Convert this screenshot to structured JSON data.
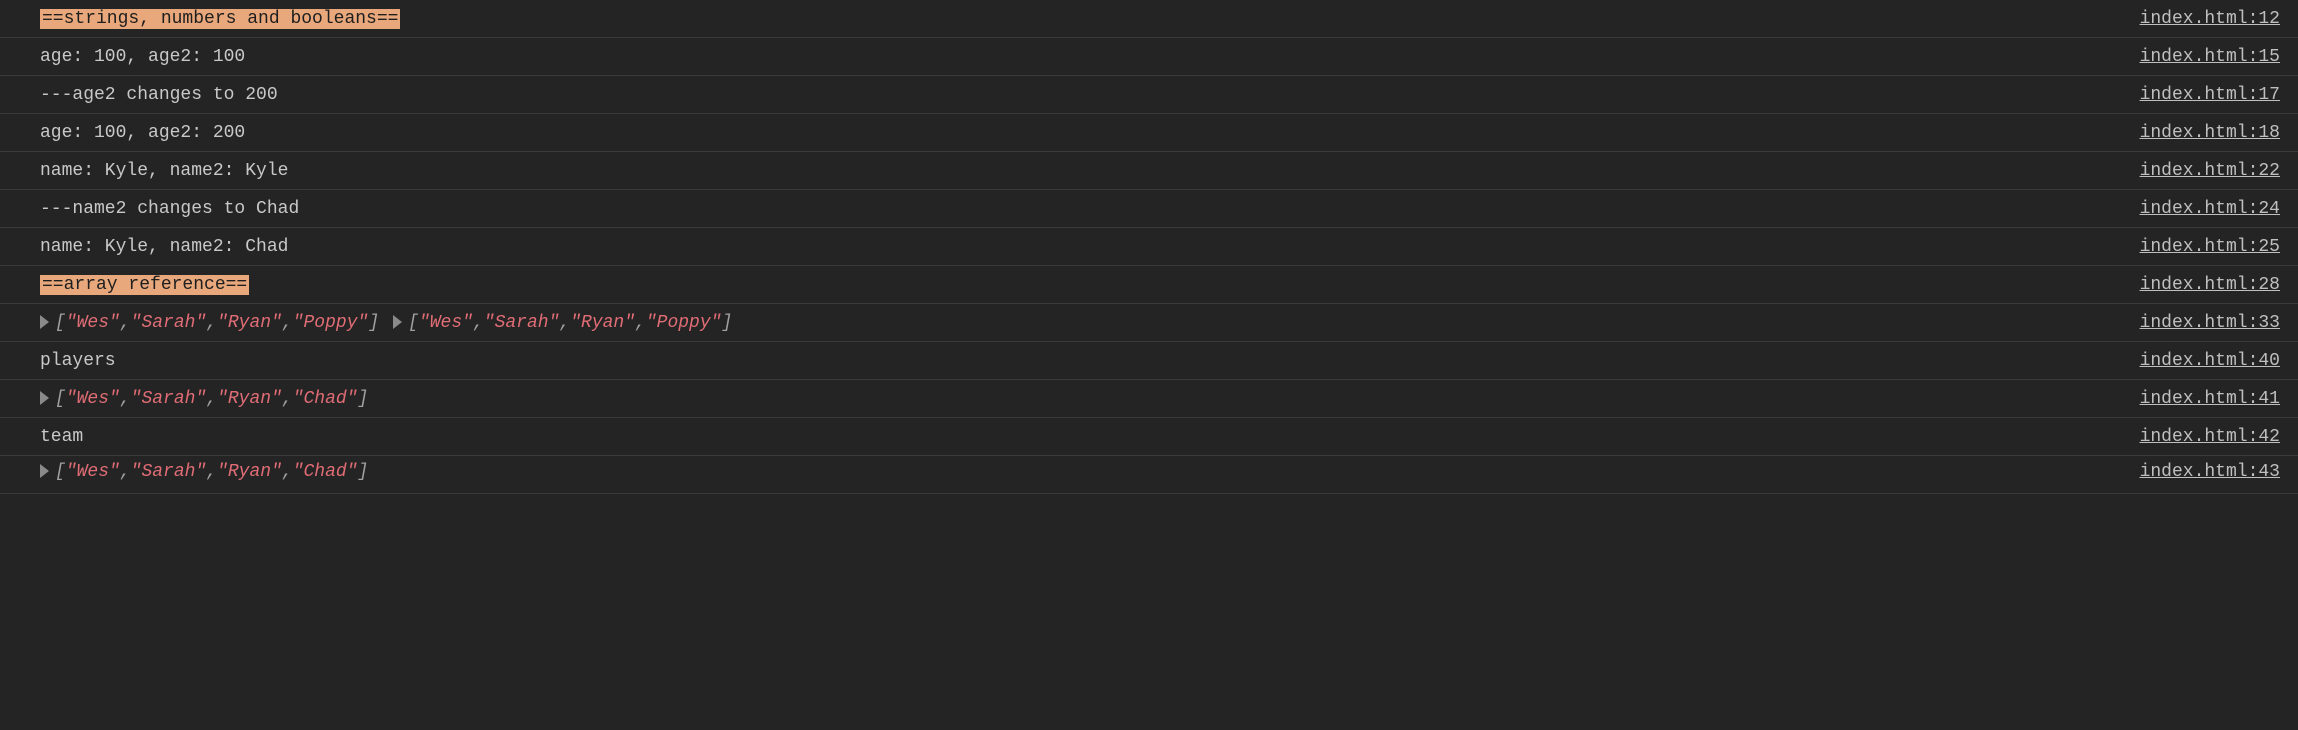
{
  "rows": [
    {
      "type": "hl",
      "text": "==strings, numbers and booleans==",
      "source": "index.html:12"
    },
    {
      "type": "plain",
      "text": "age: 100, age2: 100",
      "source": "index.html:15"
    },
    {
      "type": "plain",
      "text": "---age2 changes to 200",
      "source": "index.html:17"
    },
    {
      "type": "plain",
      "text": "age: 100, age2: 200",
      "source": "index.html:18"
    },
    {
      "type": "plain",
      "text": "name: Kyle, name2: Kyle",
      "source": "index.html:22"
    },
    {
      "type": "plain",
      "text": "---name2 changes to Chad",
      "source": "index.html:24"
    },
    {
      "type": "plain",
      "text": "name: Kyle, name2: Chad",
      "source": "index.html:25"
    },
    {
      "type": "hl",
      "text": "==array reference==",
      "source": "index.html:28"
    },
    {
      "type": "arrays",
      "arrays": [
        [
          "\"Wes\"",
          "\"Sarah\"",
          "\"Ryan\"",
          "\"Poppy\""
        ],
        [
          "\"Wes\"",
          "\"Sarah\"",
          "\"Ryan\"",
          "\"Poppy\""
        ]
      ],
      "source": "index.html:33"
    },
    {
      "type": "plain",
      "text": "players",
      "source": "index.html:40"
    },
    {
      "type": "arrays",
      "arrays": [
        [
          "\"Wes\"",
          "\"Sarah\"",
          "\"Ryan\"",
          "\"Chad\""
        ]
      ],
      "source": "index.html:41"
    },
    {
      "type": "plain",
      "text": "team",
      "source": "index.html:42"
    },
    {
      "type": "arrays-cut",
      "arrays": [
        [
          "\"Wes\"",
          "\"Sarah\"",
          "\"Ryan\"",
          "\"Chad\""
        ]
      ],
      "source": "index.html:43"
    }
  ]
}
